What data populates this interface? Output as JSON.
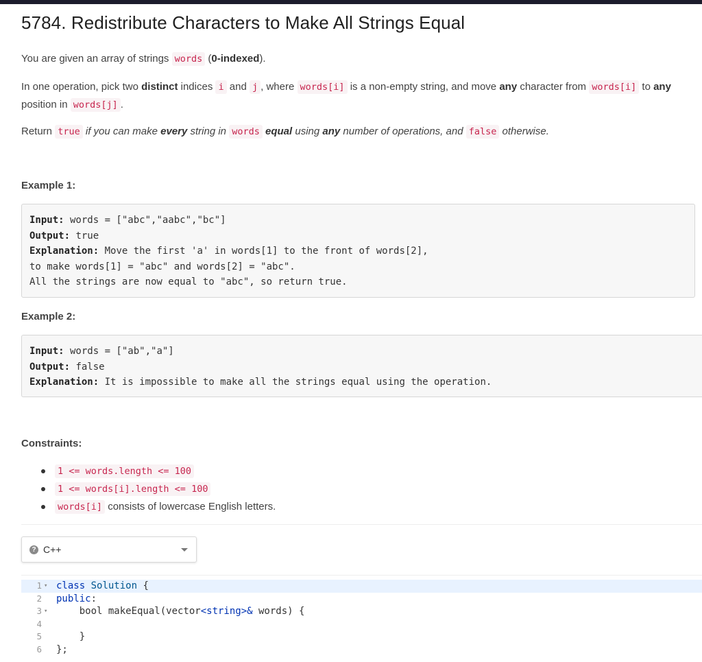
{
  "problem": {
    "title": "5784. Redistribute Characters to Make All Strings Equal",
    "desc1": {
      "t1": "You are given an array of strings ",
      "c1": "words",
      "t2": " (",
      "b1": "0-indexed",
      "t3": ")."
    },
    "desc2": {
      "t1": "In one operation, pick two ",
      "b1": "distinct",
      "t2": " indices ",
      "c1": "i",
      "t3": " and ",
      "c2": "j",
      "t4": ", where ",
      "c3": "words[i]",
      "t5": " is a non-empty string, and move ",
      "b2": "any",
      "t6": " character from ",
      "c4": "words[i]",
      "t7": " to ",
      "b3": "any",
      "t8": " position in ",
      "c5": "words[j]",
      "t9": "."
    },
    "desc3": {
      "t1": "Return ",
      "c1": "true",
      "i1": " if you can make ",
      "b1": "every",
      "i2": " string in ",
      "c2": "words",
      "b2": " equal",
      "i3": " using ",
      "b3": "any",
      "i4": " number of operations, and ",
      "c3": "false",
      "i5": " otherwise."
    }
  },
  "examples": [
    {
      "heading": "Example 1:",
      "input_label": "Input:",
      "input": " words = [\"abc\",\"aabc\",\"bc\"]",
      "output_label": "Output:",
      "output": " true",
      "explanation_label": "Explanation:",
      "explanation": " Move the first 'a' in words[1] to the front of words[2],",
      "line2": "to make words[1] = \"abc\" and words[2] = \"abc\".",
      "line3": "All the strings are now equal to \"abc\", so return true."
    },
    {
      "heading": "Example 2:",
      "input_label": "Input:",
      "input": " words = [\"ab\",\"a\"]",
      "output_label": "Output:",
      "output": " false",
      "explanation_label": "Explanation:",
      "explanation": " It is impossible to make all the strings equal using the operation."
    }
  ],
  "constraints": {
    "heading": "Constraints:",
    "items": [
      "1 <= words.length <= 100",
      "1 <= words[i].length <= 100"
    ],
    "item3_code": "words[i]",
    "item3_text": " consists of lowercase English letters."
  },
  "editor": {
    "language": "C++",
    "help_icon_glyph": "?",
    "lines": [
      {
        "num": "1",
        "fold": "▾",
        "kw": "class",
        "rest": " ",
        "ty": "Solution",
        "end": " {"
      },
      {
        "num": "2",
        "fold": "",
        "kw": "public",
        "rest": "",
        "ty": "",
        "end": ":"
      },
      {
        "num": "3",
        "fold": "▾",
        "kw": "",
        "rest": "    bool makeEqual(vector",
        "ty": "<string>&",
        "end": " words) {"
      },
      {
        "num": "4",
        "fold": "",
        "kw": "",
        "rest": "",
        "ty": "",
        "end": ""
      },
      {
        "num": "5",
        "fold": "",
        "kw": "",
        "rest": "    }",
        "ty": "",
        "end": ""
      },
      {
        "num": "6",
        "fold": "",
        "kw": "",
        "rest": "};",
        "ty": "",
        "end": ""
      }
    ]
  },
  "colors": {
    "code_text": "#c7254e",
    "code_bg": "#f9f2f4",
    "keyword": "#0033b3",
    "active_line": "#e8f2ff"
  }
}
